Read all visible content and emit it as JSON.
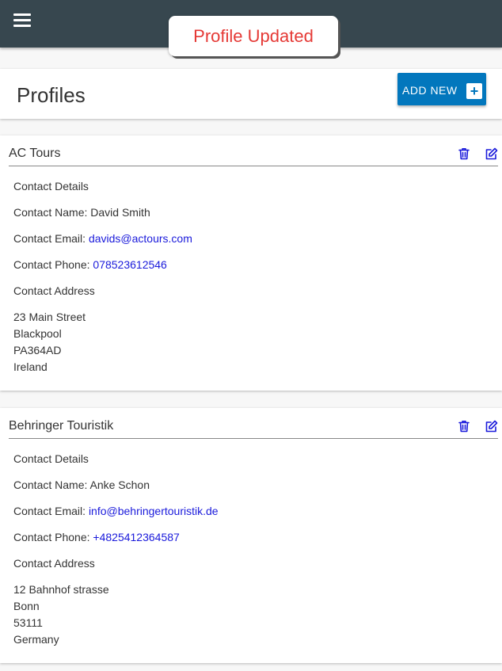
{
  "toast": {
    "message": "Profile Updated"
  },
  "header": {
    "title": "Profiles",
    "add_label": "ADD NEW",
    "add_icon": "plus-icon"
  },
  "profiles": [
    {
      "name": "AC Tours",
      "details_heading": "Contact Details",
      "name_label": "Contact Name: ",
      "contact_name": "David Smith",
      "email_label": "Contact Email: ",
      "email": "davids@actours.com",
      "phone_label": "Contact Phone: ",
      "phone": "078523612546",
      "address_heading": "Contact Address",
      "address": [
        "23 Main Street",
        "Blackpool",
        "PA364AD",
        "Ireland"
      ]
    },
    {
      "name": "Behringer Touristik",
      "details_heading": "Contact Details",
      "name_label": "Contact Name: ",
      "contact_name": "Anke Schon",
      "email_label": "Contact Email: ",
      "email": "info@behringertouristik.de",
      "phone_label": "Contact Phone: ",
      "phone": "+4825412364587",
      "address_heading": "Contact Address",
      "address": [
        "12 Bahnhof strasse",
        "Bonn",
        "53111",
        "Germany"
      ]
    }
  ],
  "colors": {
    "appbar": "#37474f",
    "accent": "#0277bd",
    "toast_text": "#e53935",
    "link": "#1a1adb",
    "icon": "#1a1adb"
  }
}
